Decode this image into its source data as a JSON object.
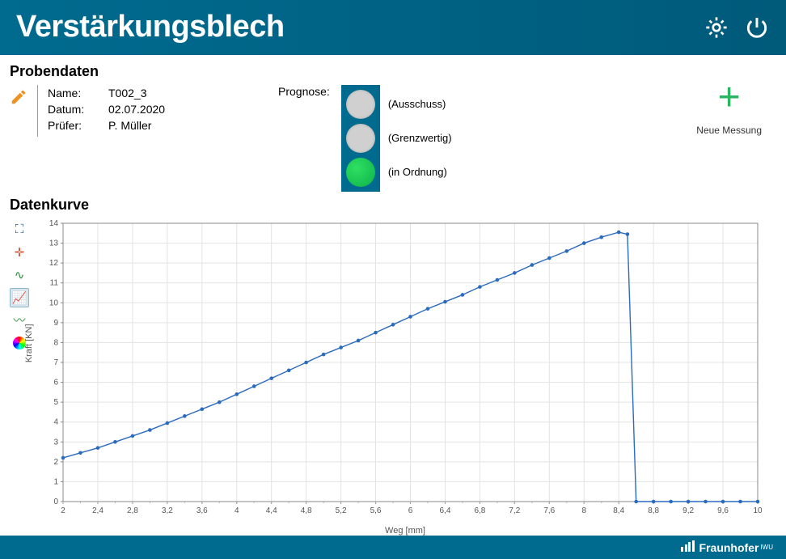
{
  "header": {
    "title": "Verstärkungsblech",
    "settings_icon": "gear-icon",
    "power_icon": "power-icon"
  },
  "probendaten": {
    "section_title": "Probendaten",
    "name_label": "Name:",
    "name_value": "T002_3",
    "datum_label": "Datum:",
    "datum_value": "02.07.2020",
    "pruefer_label": "Prüfer:",
    "pruefer_value": "P. Müller"
  },
  "prognose": {
    "label": "Prognose:",
    "states": [
      {
        "key": "ausschuss",
        "label": "(Ausschuss)",
        "active": false
      },
      {
        "key": "grenzwertig",
        "label": "(Grenzwertig)",
        "active": false
      },
      {
        "key": "in_ordnung",
        "label": "(in Ordnung)",
        "active": true
      }
    ]
  },
  "new_measurement": {
    "label": "Neue Messung"
  },
  "datenkurve": {
    "section_title": "Datenkurve"
  },
  "chart_tools": [
    {
      "name": "zoom-fit-icon",
      "glyph": "⛶",
      "active": false,
      "color": "#2a5b8f"
    },
    {
      "name": "crosshair-icon",
      "glyph": "✛",
      "active": false,
      "color": "#d05030"
    },
    {
      "name": "signal-icon",
      "glyph": "∿",
      "active": false,
      "color": "#2e8b3a"
    },
    {
      "name": "line-chart-icon",
      "glyph": "📈",
      "active": true,
      "color": "#2a5b8f"
    },
    {
      "name": "area-chart-icon",
      "glyph": "〰",
      "active": false,
      "color": "#2e8b3a"
    },
    {
      "name": "color-wheel-icon",
      "glyph": "◉",
      "active": false,
      "color": ""
    }
  ],
  "chart_data": {
    "type": "line",
    "title": "",
    "xlabel": "Weg [mm]",
    "ylabel": "Kraft [KN]",
    "xlim": [
      2,
      10
    ],
    "ylim": [
      0,
      14
    ],
    "x_ticks": [
      2,
      2.4,
      2.8,
      3.2,
      3.6,
      4,
      4.4,
      4.8,
      5.2,
      5.6,
      6,
      6.4,
      6.8,
      7.2,
      7.6,
      8,
      8.4,
      8.8,
      9.2,
      9.6,
      10
    ],
    "y_ticks": [
      0,
      1,
      2,
      3,
      4,
      5,
      6,
      7,
      8,
      9,
      10,
      11,
      12,
      13,
      14
    ],
    "series": [
      {
        "name": "Kraft",
        "color": "#2a6bbf",
        "x": [
          2.0,
          2.2,
          2.4,
          2.6,
          2.8,
          3.0,
          3.2,
          3.4,
          3.6,
          3.8,
          4.0,
          4.2,
          4.4,
          4.6,
          4.8,
          5.0,
          5.2,
          5.4,
          5.6,
          5.8,
          6.0,
          6.2,
          6.4,
          6.6,
          6.8,
          7.0,
          7.2,
          7.4,
          7.6,
          7.8,
          8.0,
          8.2,
          8.4,
          8.5,
          8.6,
          8.8,
          9.0,
          9.2,
          9.4,
          9.6,
          9.8,
          10.0
        ],
        "y": [
          2.2,
          2.45,
          2.7,
          3.0,
          3.3,
          3.6,
          3.95,
          4.3,
          4.65,
          5.0,
          5.4,
          5.8,
          6.2,
          6.6,
          7.0,
          7.4,
          7.75,
          8.1,
          8.5,
          8.9,
          9.3,
          9.7,
          10.05,
          10.4,
          10.8,
          11.15,
          11.5,
          11.9,
          12.25,
          12.6,
          13.0,
          13.3,
          13.55,
          13.45,
          0.0,
          0.0,
          0.0,
          0.0,
          0.0,
          0.0,
          0.0,
          0.0
        ]
      }
    ]
  },
  "footer": {
    "brand": "Fraunhofer",
    "unit": "IWU"
  }
}
